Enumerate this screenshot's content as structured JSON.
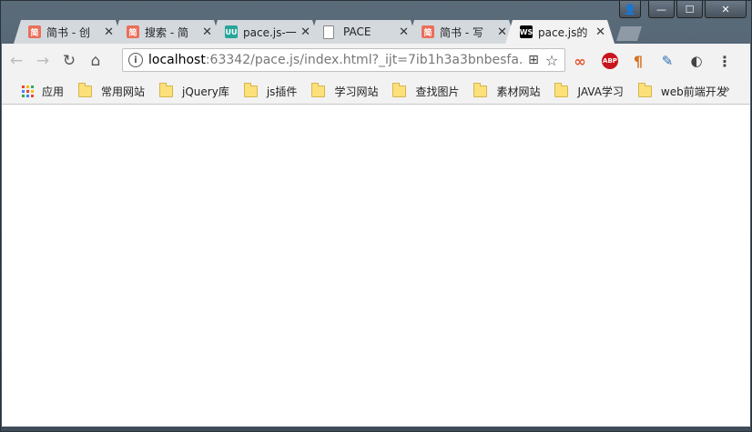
{
  "window": {
    "controls": {
      "user": "👤",
      "minimize": "—",
      "maximize": "☐",
      "close": "✕"
    }
  },
  "tabs": [
    {
      "title": "简书 - 创",
      "favicon": "简",
      "favicon_color": "#ea6f5a"
    },
    {
      "title": "搜索 - 简",
      "favicon": "简",
      "favicon_color": "#ea6f5a"
    },
    {
      "title": "pace.js-一",
      "favicon": "UU",
      "favicon_color": "#26a69a"
    },
    {
      "title": "PACE",
      "favicon": "",
      "favicon_color": "#ffffff"
    },
    {
      "title": "简书 - 写",
      "favicon": "简",
      "favicon_color": "#ea6f5a"
    },
    {
      "title": "pace.js的",
      "favicon": "WS",
      "favicon_color": "#000000",
      "active": true
    }
  ],
  "toolbar": {
    "back": "←",
    "forward": "→",
    "reload": "↻",
    "home": "⌂",
    "url_host": "localhost",
    "url_rest": ":63342/pace.js/index.html?_ijt=7ib1h3a3bnbesfa...",
    "translate_icon": "⊞",
    "star_icon": "☆",
    "menu_icon": "⋮"
  },
  "extensions": [
    {
      "name": "infinity",
      "label": "∞",
      "color": "#e8542e"
    },
    {
      "name": "adblock-plus",
      "label": "ABP",
      "color": "#c7161d"
    },
    {
      "name": "paragraph",
      "label": "¶",
      "color": "#d9701f"
    },
    {
      "name": "tool",
      "label": "✎",
      "color": "#2c6fb7"
    },
    {
      "name": "sync",
      "label": "◐",
      "color": "#444444"
    }
  ],
  "bookmarks": {
    "apps_label": "应用",
    "items": [
      "常用网站",
      "jQuery库",
      "js插件",
      "学习网站",
      "查找图片",
      "素材网站",
      "JAVA学习",
      "web前端开发"
    ],
    "more": "»"
  },
  "colors": {
    "app_grid": [
      "#ea4335",
      "#fbbc05",
      "#34a853",
      "#4285f4",
      "#ea4335",
      "#fbbc05",
      "#34a853",
      "#4285f4",
      "#ea4335"
    ]
  }
}
